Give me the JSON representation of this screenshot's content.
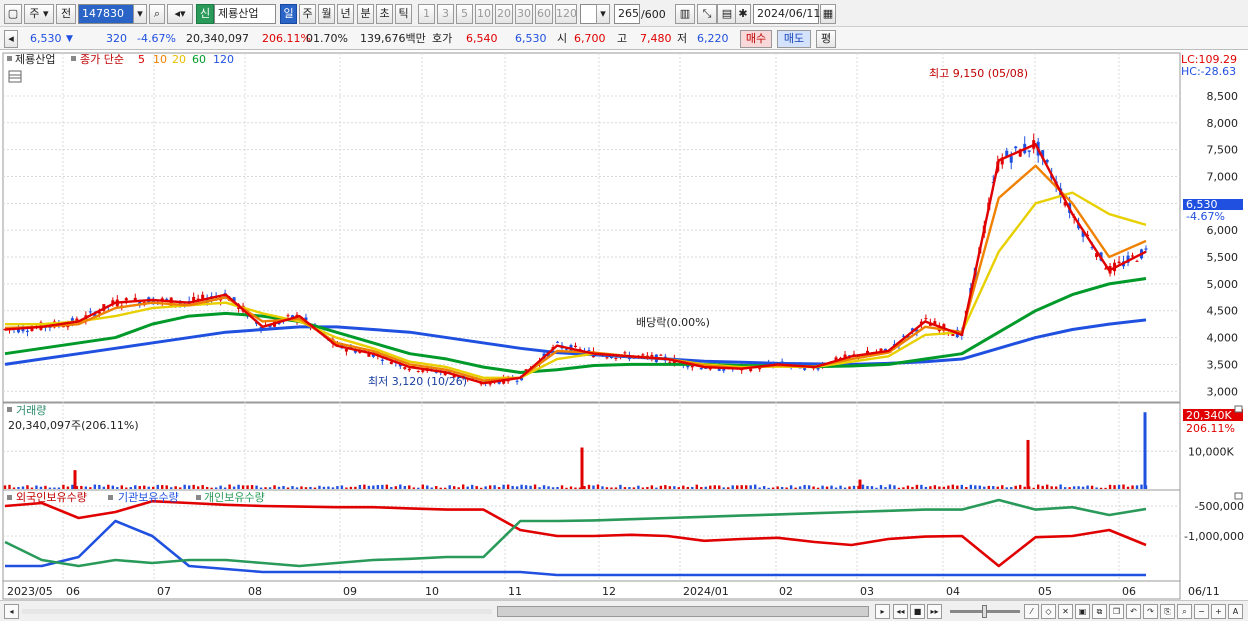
{
  "toolbar": {
    "type_label": "주",
    "mode_label": "전",
    "code": "147830",
    "badge": "신",
    "stock_name": "제룡산업",
    "period_tabs": [
      "일",
      "주",
      "월",
      "년",
      "분",
      "초",
      "틱"
    ],
    "interval_tabs": [
      "1",
      "3",
      "5",
      "10",
      "20",
      "30",
      "60",
      "120"
    ],
    "count_value": "265",
    "count_max": "/600",
    "date_value": "2024/06/11"
  },
  "quote": {
    "price": "6,530",
    "change": "320",
    "change_pct": "-4.67%",
    "volume": "20,340,097",
    "volume_ratio": "206.11%",
    "turnover_pct": "01.70%",
    "amount": "139,676백만",
    "quote_label": "호가",
    "ask": "6,540",
    "bid": "6,530",
    "open_label": "시",
    "open": "6,700",
    "high_label": "고",
    "high": "7,480",
    "low_label": "저",
    "low": "6,220",
    "buy_button": "매수",
    "sell_button": "매도",
    "avg_button": "평"
  },
  "legend": {
    "stock_name": "제룡산업",
    "ma_title": "종가 단순",
    "ma_periods": [
      {
        "label": "5",
        "color": "#e00000"
      },
      {
        "label": "10",
        "color": "#f08000"
      },
      {
        "label": "20",
        "color": "#e8d000"
      },
      {
        "label": "60",
        "color": "#009a2a"
      },
      {
        "label": "120",
        "color": "#2050e0"
      }
    ]
  },
  "price_panel": {
    "lc_label": "LC:109.29",
    "hc_label": "HC:-28.63",
    "yticks": [
      "8,500",
      "8,000",
      "7,500",
      "7,000",
      "6,500",
      "6,000",
      "5,500",
      "5,000",
      "4,500",
      "4,000",
      "3,500",
      "3,000"
    ],
    "current_price_tag": "6,530",
    "current_pct_tag": "-4.67%",
    "high_annotation": "최고 9,150 (05/08)",
    "low_annotation": "최저 3,120 (10/26)",
    "dividend_annotation": "배당락(0.00%)"
  },
  "volume_panel": {
    "title": "거래량",
    "subtitle": "20,340,097주(206.11%)",
    "tag_value": "20,340K",
    "tag_pct": "206.11%",
    "ytick": "10,000K"
  },
  "holder_panel": {
    "series_labels": [
      {
        "label": "외국인보유수량",
        "color": "#e00000"
      },
      {
        "label": "기관보유수량",
        "color": "#2050e0"
      },
      {
        "label": "개인보유수량",
        "color": "#2a9a5a"
      }
    ],
    "yticks": [
      "-500,000",
      "-1,000,000"
    ]
  },
  "xaxis": {
    "labels": [
      "2023/05",
      "06",
      "07",
      "08",
      "09",
      "10",
      "11",
      "12",
      "2024/01",
      "02",
      "03",
      "04",
      "05",
      "06",
      "06/11"
    ]
  },
  "colors": {
    "up": "#e00000",
    "down": "#2050e0",
    "grid": "#d8d8d8",
    "tag_blue": "#2050e0",
    "tag_red": "#e00000"
  },
  "chart_data": [
    {
      "type": "line",
      "title": "",
      "series": [
        {
          "name": "5",
          "values": [
            4150,
            4200,
            4300,
            4650,
            4700,
            4650,
            4800,
            4200,
            4400,
            3850,
            3700,
            3450,
            3350,
            3150,
            3250,
            3850,
            3700,
            3650,
            3600,
            3450,
            3420,
            3500,
            3450,
            3650,
            3750,
            4300,
            4050,
            7300,
            7600,
            6300,
            5250,
            5600
          ]
        },
        {
          "name": "10",
          "values": [
            4180,
            4200,
            4250,
            4550,
            4650,
            4600,
            4750,
            4300,
            4350,
            3900,
            3750,
            3500,
            3400,
            3200,
            3250,
            3750,
            3720,
            3650,
            3600,
            3480,
            3430,
            3480,
            3460,
            3600,
            3720,
            4200,
            4100,
            6600,
            7200,
            6500,
            5500,
            5800
          ]
        },
        {
          "name": "20",
          "values": [
            4250,
            4250,
            4300,
            4400,
            4550,
            4600,
            4650,
            4450,
            4300,
            4000,
            3800,
            3550,
            3450,
            3250,
            3250,
            3600,
            3700,
            3650,
            3600,
            3500,
            3450,
            3460,
            3450,
            3550,
            3650,
            4050,
            4100,
            5600,
            6500,
            6700,
            6300,
            6100
          ]
        },
        {
          "name": "60",
          "values": [
            3700,
            3800,
            3900,
            4000,
            4250,
            4400,
            4450,
            4400,
            4300,
            4100,
            3900,
            3700,
            3600,
            3450,
            3350,
            3400,
            3480,
            3500,
            3500,
            3500,
            3480,
            3470,
            3460,
            3470,
            3500,
            3600,
            3700,
            4100,
            4500,
            4800,
            5000,
            5100
          ]
        },
        {
          "name": "120",
          "values": [
            3500,
            3600,
            3700,
            3800,
            3900,
            4000,
            4100,
            4150,
            4200,
            4200,
            4150,
            4100,
            4000,
            3900,
            3800,
            3720,
            3680,
            3640,
            3600,
            3560,
            3540,
            3520,
            3510,
            3500,
            3520,
            3550,
            3600,
            3800,
            4000,
            4150,
            4250,
            4330
          ]
        }
      ],
      "ylim": [
        2800,
        9300
      ]
    },
    {
      "type": "bar",
      "title": "",
      "categories": [
        "06",
        "12",
        "04",
        "05",
        "06"
      ],
      "values": [
        5000,
        11000,
        2500,
        13000,
        20340
      ],
      "ylim": [
        0,
        22000
      ]
    },
    {
      "type": "line",
      "title": "",
      "series": [
        {
          "name": "외국인보유수량",
          "values": [
            -500000,
            -450000,
            -700000,
            -600000,
            -420000,
            -450000,
            -480000,
            -500000,
            -510000,
            -520000,
            -520000,
            -540000,
            -560000,
            -560000,
            -900000,
            -1000000,
            -1000000,
            -980000,
            -1000000,
            -1080000,
            -1050000,
            -1030000,
            -1100000,
            -1150000,
            -1050000,
            -1010000,
            -1000000,
            -1500000,
            -1020000,
            -1000000,
            -900000,
            -1150000
          ]
        },
        {
          "name": "기관보유수량",
          "values": [
            -1500000,
            -1500000,
            -1350000,
            -750000,
            -1000000,
            -1500000,
            -1550000,
            -1600000,
            -1600000,
            -1600000,
            -1600000,
            -1600000,
            -1600000,
            -1600000,
            -1600000,
            -1650000,
            -1650000,
            -1650000,
            -1650000,
            -1650000,
            -1650000,
            -1650000,
            -1650000,
            -1650000,
            -1650000,
            -1650000,
            -1650000,
            -1650000,
            -1650000,
            -1650000,
            -1650000,
            -1650000
          ]
        },
        {
          "name": "개인보유수량",
          "values": [
            -1100000,
            -1400000,
            -1500000,
            -1400000,
            -1450000,
            -1400000,
            -1400000,
            -1450000,
            -1500000,
            -1450000,
            -1400000,
            -1380000,
            -1350000,
            -1350000,
            -750000,
            -750000,
            -740000,
            -720000,
            -700000,
            -680000,
            -660000,
            -640000,
            -620000,
            -600000,
            -580000,
            -560000,
            -560000,
            -400000,
            -560000,
            -520000,
            -650000,
            -550000
          ]
        }
      ],
      "ylim": [
        -1750000,
        -250000
      ]
    }
  ]
}
